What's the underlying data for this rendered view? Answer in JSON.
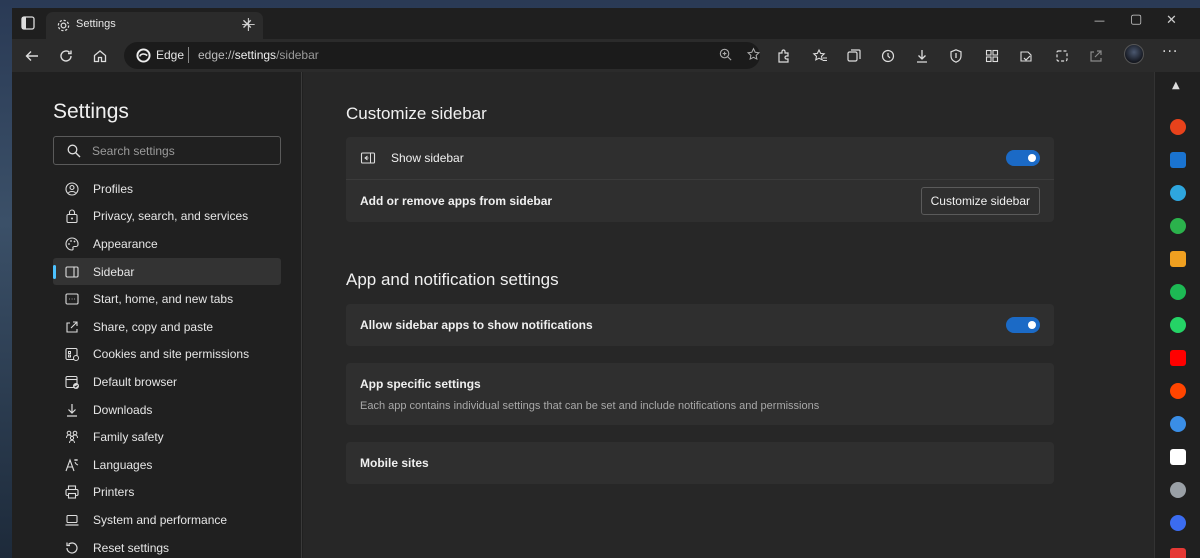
{
  "tab": {
    "title": "Settings",
    "close": "✕",
    "new_tab": "+"
  },
  "window_controls": {
    "minimize": "—",
    "maximize": "▢",
    "close": "✕"
  },
  "address_bar": {
    "site_label": "Edge",
    "url_prefix": "edge://",
    "url_host": "settings",
    "url_path": "/sidebar"
  },
  "more_menu": "···",
  "left_nav": {
    "title": "Settings",
    "search_placeholder": "Search settings",
    "items": [
      {
        "label": "Profiles",
        "icon": "profile-icon"
      },
      {
        "label": "Privacy, search, and services",
        "icon": "lock-icon"
      },
      {
        "label": "Appearance",
        "icon": "palette-icon"
      },
      {
        "label": "Sidebar",
        "icon": "sidebar-icon",
        "active": true
      },
      {
        "label": "Start, home, and new tabs",
        "icon": "start-page-icon"
      },
      {
        "label": "Share, copy and paste",
        "icon": "share-icon"
      },
      {
        "label": "Cookies and site permissions",
        "icon": "cookies-icon"
      },
      {
        "label": "Default browser",
        "icon": "default-browser-icon"
      },
      {
        "label": "Downloads",
        "icon": "download-icon"
      },
      {
        "label": "Family safety",
        "icon": "family-icon"
      },
      {
        "label": "Languages",
        "icon": "language-icon"
      },
      {
        "label": "Printers",
        "icon": "printer-icon"
      },
      {
        "label": "System and performance",
        "icon": "laptop-icon"
      },
      {
        "label": "Reset settings",
        "icon": "reset-icon"
      }
    ]
  },
  "main": {
    "customize_heading": "Customize sidebar",
    "show_sidebar_label": "Show sidebar",
    "show_sidebar_on": true,
    "add_remove_label": "Add or remove apps from sidebar",
    "customize_button": "Customize sidebar",
    "app_notif_heading": "App and notification settings",
    "allow_notif_label": "Allow sidebar apps to show notifications",
    "allow_notif_on": true,
    "app_specific_label": "App specific settings",
    "app_specific_desc": "Each app contains individual settings that can be set and include notifications and permissions",
    "mobile_sites_label": "Mobile sites"
  },
  "sidebar_apps": [
    {
      "name": "office-app-icon",
      "color": "#e8421b"
    },
    {
      "name": "outlook-app-icon",
      "color": "#1a73d0"
    },
    {
      "name": "telegram-app-icon",
      "color": "#2ea6de"
    },
    {
      "name": "feedly-app-icon",
      "color": "#2bb24c"
    },
    {
      "name": "deezer-app-icon",
      "color": "#f0a020"
    },
    {
      "name": "spotify-app-icon",
      "color": "#1db954"
    },
    {
      "name": "whatsapp-app-icon",
      "color": "#25d366"
    },
    {
      "name": "youtube-app-icon",
      "color": "#ff0000"
    },
    {
      "name": "reddit-app-icon",
      "color": "#ff4500"
    },
    {
      "name": "screenshot-app-icon",
      "color": "#3a8ee6"
    },
    {
      "name": "wikipedia-app-icon",
      "color": "#ffffff"
    },
    {
      "name": "pen-app-icon",
      "color": "#9aa0a6"
    },
    {
      "name": "notion-app-icon",
      "color": "#3b6cf0"
    },
    {
      "name": "mail-app-icon",
      "color": "#e53935"
    }
  ],
  "accent_color": "#1b6ac6"
}
